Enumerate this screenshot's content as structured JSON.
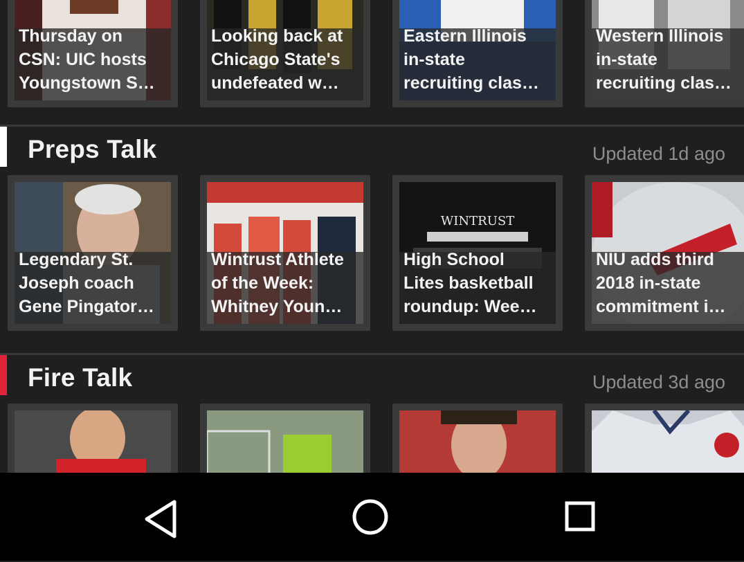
{
  "top_row": {
    "cards": [
      {
        "title": "Thursday on\nCSN: UIC hosts\nYoungstown S…"
      },
      {
        "title": "Looking back at\nChicago State's\nundefeated w…"
      },
      {
        "title": "Eastern Illinois\nin-state\nrecruiting clas…"
      },
      {
        "title": "Western Illinois\nin-state\nrecruiting clas…"
      }
    ]
  },
  "sections": [
    {
      "title": "Preps Talk",
      "updated": "Updated 1d ago",
      "accent": "#ffffff",
      "cards": [
        {
          "title": "Legendary St.\nJoseph coach\nGene Pingator…"
        },
        {
          "title": "Wintrust Athlete\nof the Week:\nWhitney Youn…"
        },
        {
          "title": "High School\nLites basketball\nroundup: Wee…"
        },
        {
          "title": "NIU adds third\n2018 in-state\ncommitment i…"
        }
      ]
    },
    {
      "title": "Fire Talk",
      "updated": "Updated 3d ago",
      "accent": "#e1243a",
      "cards": [
        {
          "title": ""
        },
        {
          "title": ""
        },
        {
          "title": ""
        },
        {
          "title": ""
        }
      ]
    }
  ],
  "thumb_texts": {
    "wintrust_sign": "WINTRUST"
  },
  "icons": {
    "back": "back-triangle-icon",
    "home": "home-circle-icon",
    "recent": "recent-apps-square-icon"
  }
}
